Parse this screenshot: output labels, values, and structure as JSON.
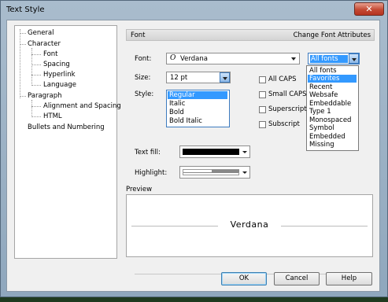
{
  "window": {
    "title": "Text Style",
    "close_glyph": "✕"
  },
  "tree": {
    "items": [
      {
        "label": "General"
      },
      {
        "label": "Character"
      },
      {
        "label": "Font"
      },
      {
        "label": "Spacing"
      },
      {
        "label": "Hyperlink"
      },
      {
        "label": "Language"
      },
      {
        "label": "Paragraph"
      },
      {
        "label": "Alignment and Spacing"
      },
      {
        "label": "HTML"
      },
      {
        "label": "Bullets and Numbering"
      }
    ]
  },
  "section": {
    "title": "Font",
    "subtitle": "Change Font Attributes"
  },
  "font": {
    "label": "Font:",
    "value": "Verdana",
    "font_icon": "O"
  },
  "filter": {
    "value": "All fonts",
    "options": [
      "All fonts",
      "Favorites",
      "Recent",
      "Websafe",
      "Embeddable",
      "Type 1",
      "Monospaced",
      "Symbol",
      "Embedded",
      "Missing"
    ],
    "selected_index": 1
  },
  "size": {
    "label": "Size:",
    "value": "12 pt"
  },
  "style": {
    "label": "Style:",
    "options": [
      "Regular",
      "Italic",
      "Bold",
      "Bold Italic"
    ],
    "selected_index": 0
  },
  "effects": {
    "all_caps": "All CAPS",
    "small_caps": "Small CAPS",
    "superscript": "Superscript",
    "subscript": "Subscript"
  },
  "text_fill": {
    "label": "Text fill:",
    "color": "#000000"
  },
  "highlight": {
    "label": "Highlight:"
  },
  "preview": {
    "label": "Preview",
    "text": "Verdana"
  },
  "buttons": {
    "ok": "OK",
    "cancel": "Cancel",
    "help": "Help"
  }
}
